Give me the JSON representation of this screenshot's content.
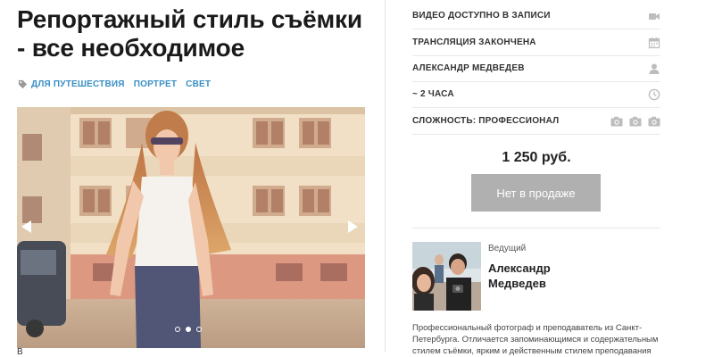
{
  "course": {
    "title": "Репортажный стиль съёмки - все необходимое",
    "tags": [
      "ДЛЯ ПУТЕШЕСТВИЯ",
      "ПОРТРЕТ",
      "СВЕТ"
    ],
    "below_image_text": "В"
  },
  "slider": {
    "dots_count": 3,
    "active_dot": 2
  },
  "info": {
    "rows": [
      {
        "label": "ВИДЕО ДОСТУПНО В ЗАПИСИ",
        "icon": "video-camera-icon"
      },
      {
        "label": "ТРАНСЛЯЦИЯ ЗАКОНЧЕНА",
        "icon": "calendar-icon"
      },
      {
        "label": "АЛЕКСАНДР МЕДВЕДЕВ",
        "icon": "user-icon"
      },
      {
        "label": "~ 2 ЧАСА",
        "icon": "clock-icon"
      },
      {
        "label": "СЛОЖНОСТЬ: ПРОФЕССИОНАЛ",
        "icon": "camera-icon"
      }
    ],
    "difficulty_level": 3
  },
  "purchase": {
    "price": "1 250 руб.",
    "button_label": "Нет в продаже"
  },
  "host": {
    "role": "Ведущий",
    "name": "Александр Медведев",
    "bio": "Профессиональный фотограф и преподаватель из Санкт-Петербурга. Отличается запоминающимся и содержательным стилем съёмки, ярким и действенным стилем преподавания"
  },
  "colors": {
    "tag_link": "#3a8fc4",
    "button_disabled": "#b0b0b0",
    "icon_gray": "#bdbdbd"
  }
}
